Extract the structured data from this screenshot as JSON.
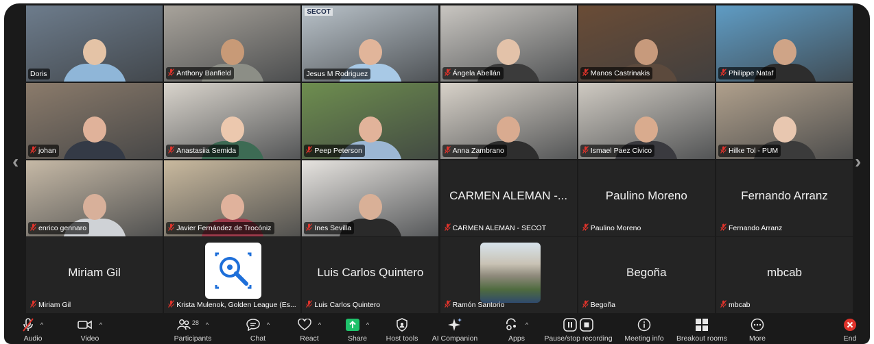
{
  "navigation": {
    "prev_arrow": "‹",
    "next_arrow": "›"
  },
  "tiles": [
    {
      "name": "Doris",
      "muted": false,
      "video": true,
      "bg": "#6d7c8c",
      "skin": "#e4c3a6",
      "shirt": "#8fb6d8"
    },
    {
      "name": "Anthony Banfield",
      "muted": true,
      "video": true,
      "bg": "#a8a39b",
      "skin": "#c89a77",
      "shirt": "#8c8e86"
    },
    {
      "name": "Jesus M Rodriguez",
      "muted": false,
      "video": true,
      "bg": "#b9c2c9",
      "skin": "#e1b59a",
      "shirt": "#a8c9e6",
      "overlay": "SECOT"
    },
    {
      "name": "Ángela Abellán",
      "muted": true,
      "video": true,
      "bg": "#c9c6c1",
      "skin": "#e3c2a9",
      "shirt": "#3b3b3b"
    },
    {
      "name": "Manos Castrinakis",
      "muted": true,
      "video": true,
      "bg": "#6a4c36",
      "skin": "#c79a7c",
      "shirt": "#5c4a3d"
    },
    {
      "name": "Philippe Nataf",
      "muted": true,
      "video": true,
      "bg": "#5f9cc4",
      "skin": "#cfa487",
      "shirt": "#2d2d2d"
    },
    {
      "name": "johan",
      "muted": true,
      "video": true,
      "bg": "#8b7b6b",
      "skin": "#e0b29a",
      "shirt": "#343a46"
    },
    {
      "name": "Anastasiia Semida",
      "muted": true,
      "video": true,
      "bg": "#d9d4cc",
      "skin": "#ecc8ae",
      "shirt": "#3d6b54"
    },
    {
      "name": "Peep Peterson",
      "muted": true,
      "video": true,
      "bg": "#6e8e4f",
      "skin": "#e2b39a",
      "shirt": "#9cb7d3"
    },
    {
      "name": "Anna Zambrano",
      "muted": true,
      "video": true,
      "bg": "#d8d2c9",
      "skin": "#d9ab90",
      "shirt": "#2e2e2e"
    },
    {
      "name": "Ismael Paez Civico",
      "muted": true,
      "video": true,
      "bg": "#cfcac2",
      "skin": "#d9ab8e",
      "shirt": "#3a3a3f"
    },
    {
      "name": "Hilke Tol - PUM",
      "muted": true,
      "video": true,
      "bg": "#b0a08c",
      "skin": "#e8c7b0",
      "shirt": "#3b3b3b"
    },
    {
      "name": "enrico gennaro",
      "muted": true,
      "video": true,
      "bg": "#c6b9a6",
      "skin": "#d8b09a",
      "shirt": "#cfd2d6"
    },
    {
      "name": "Javier Fernández de Trocóniz",
      "muted": true,
      "video": true,
      "bg": "#c9b99e",
      "skin": "#e0b29c",
      "shirt": "#9b3a4a"
    },
    {
      "name": "Ines Sevilla",
      "muted": true,
      "video": true,
      "bg": "#e6e3df",
      "skin": "#d9b097",
      "shirt": "#2a2a2a"
    },
    {
      "name": "CARMEN ALEMAN -  SECOT",
      "display": "CARMEN ALEMAN -...",
      "muted": true,
      "video": false
    },
    {
      "name": "Paulino Moreno",
      "display": "Paulino Moreno",
      "muted": true,
      "video": false
    },
    {
      "name": "Fernando Arranz",
      "display": "Fernando Arranz",
      "muted": true,
      "video": false
    },
    {
      "name": "Miriam Gil",
      "display": "Miriam Gil",
      "muted": true,
      "video": false
    },
    {
      "name": "Krista Mulenok, Golden League (Es...",
      "muted": true,
      "video": false,
      "avatar": "search-logo"
    },
    {
      "name": "Luis Carlos Quintero",
      "display": "Luis Carlos Quintero",
      "muted": true,
      "video": false
    },
    {
      "name": "Ramón Santorio",
      "muted": true,
      "video": false,
      "avatar": "photo"
    },
    {
      "name": "Begoña",
      "display": "Begoña",
      "muted": true,
      "video": false
    },
    {
      "name": "mbcab",
      "display": "mbcab",
      "muted": true,
      "video": false
    }
  ],
  "toolbar": {
    "audio": {
      "label": "Audio",
      "icon": "mic-muted-icon"
    },
    "video": {
      "label": "Video",
      "icon": "camera-icon"
    },
    "participants": {
      "label": "Participants",
      "count": "28",
      "icon": "participants-icon"
    },
    "chat": {
      "label": "Chat",
      "icon": "chat-icon"
    },
    "react": {
      "label": "React",
      "icon": "heart-icon"
    },
    "share": {
      "label": "Share",
      "icon": "share-icon"
    },
    "host_tools": {
      "label": "Host tools",
      "icon": "shield-icon"
    },
    "ai_companion": {
      "label": "AI Companion",
      "icon": "sparkle-icon"
    },
    "apps": {
      "label": "Apps",
      "icon": "apps-icon"
    },
    "recording": {
      "label": "Pause/stop recording",
      "icon": "pause-stop-icon"
    },
    "meeting_info": {
      "label": "Meeting info",
      "icon": "info-icon"
    },
    "breakout": {
      "label": "Breakout rooms",
      "icon": "breakout-icon"
    },
    "more": {
      "label": "More",
      "icon": "more-icon"
    },
    "end": {
      "label": "End",
      "icon": "end-icon"
    }
  },
  "colors": {
    "muted_red": "#e0332b",
    "share_green": "#1fc26b",
    "end_red": "#e0332b",
    "toolbar_bg": "#1a1a1a"
  }
}
